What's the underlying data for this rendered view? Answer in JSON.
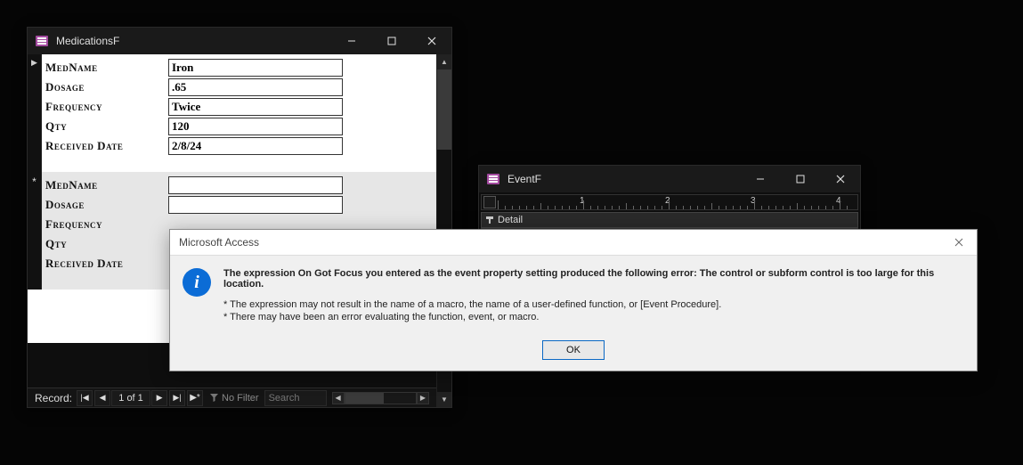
{
  "medWindow": {
    "title": "MedicationsF",
    "fields": {
      "medname_label": "MedName",
      "dosage_label": "Dosage",
      "freq_label": "Frequency",
      "qty_label": "Qty",
      "recvdate_label": "Received Date"
    },
    "record1": {
      "medname": "Iron",
      "dosage": ".65",
      "frequency": "Twice",
      "qty": "120",
      "received": "2/8/24"
    },
    "nav": {
      "label": "Record:",
      "pos": "1 of 1",
      "filter_label": "No Filter",
      "search_placeholder": "Search"
    }
  },
  "eventWindow": {
    "title": "EventF",
    "detail_label": "Detail",
    "ruler_nums": [
      "1",
      "2",
      "3",
      "4"
    ]
  },
  "dialog": {
    "title": "Microsoft Access",
    "main": "The expression On Got Focus you entered as the event property setting produced the following error: The control or subform control is too large for this location.",
    "bullet1": "* The expression may not result in the name of a macro, the name of a user-defined function, or [Event Procedure].",
    "bullet2": "* There may have been an error evaluating the function, event, or macro.",
    "ok": "OK"
  }
}
